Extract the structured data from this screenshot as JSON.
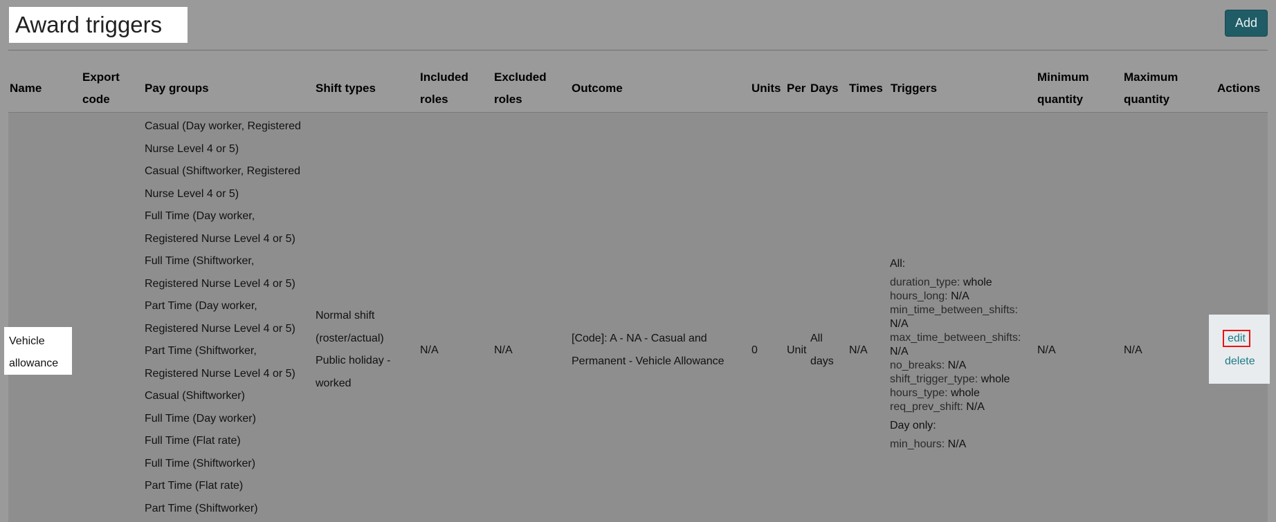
{
  "page": {
    "title": "Award triggers",
    "add_label": "Add"
  },
  "columns": {
    "name": [
      "Name"
    ],
    "export_code": [
      "Export",
      "code"
    ],
    "pay_groups": [
      "Pay groups"
    ],
    "shift_types": [
      "Shift types"
    ],
    "included_roles": [
      "Included",
      "roles"
    ],
    "excluded_roles": [
      "Excluded",
      "roles"
    ],
    "outcome": [
      "Outcome"
    ],
    "units": [
      "Units"
    ],
    "per": [
      "Per"
    ],
    "days": [
      "Days"
    ],
    "times": [
      "Times"
    ],
    "triggers": [
      "Triggers"
    ],
    "minimum_quantity": [
      "Minimum",
      "quantity"
    ],
    "maximum_quantity": [
      "Maximum",
      "quantity"
    ],
    "actions": [
      "Actions"
    ]
  },
  "row": {
    "name": [
      "Vehicle",
      "allowance"
    ],
    "pay_groups": [
      "Casual (Day worker, Registered",
      "Nurse Level 4 or 5)",
      "Casual (Shiftworker, Registered",
      "Nurse Level 4 or 5)",
      "Full Time (Day worker,",
      "Registered Nurse Level 4 or 5)",
      "Full Time (Shiftworker,",
      "Registered Nurse Level 4 or 5)",
      "Part Time (Day worker,",
      "Registered Nurse Level 4 or 5)",
      "Part Time (Shiftworker,",
      "Registered Nurse Level 4 or 5)",
      "Casual (Shiftworker)",
      "Full Time (Day worker)",
      "Full Time (Flat rate)",
      "Full Time (Shiftworker)",
      "Part Time (Flat rate)",
      "Part Time (Shiftworker)"
    ],
    "shift_types": [
      "Normal shift",
      "(roster/actual)",
      "Public holiday -",
      "worked"
    ],
    "included_roles": "N/A",
    "excluded_roles": "N/A",
    "outcome": [
      "[Code]: A - NA - Casual and",
      "Permanent - Vehicle Allowance"
    ],
    "units": "0",
    "per": "Unit",
    "days": [
      "All",
      "days"
    ],
    "times": "N/A",
    "triggers": {
      "all_label": "All:",
      "all_lines": [
        {
          "k": "duration_type:",
          "v": "whole"
        },
        {
          "k": "hours_long:",
          "v": "N/A"
        },
        {
          "k": "min_time_between_shifts:",
          "v": ""
        },
        {
          "k": "",
          "v": "N/A"
        },
        {
          "k": "max_time_between_shifts:",
          "v": ""
        },
        {
          "k": "",
          "v": "N/A"
        },
        {
          "k": "no_breaks:",
          "v": "N/A"
        },
        {
          "k": "shift_trigger_type:",
          "v": "whole"
        },
        {
          "k": "hours_type:",
          "v": "whole"
        },
        {
          "k": "req_prev_shift:",
          "v": "N/A"
        }
      ],
      "day_label": "Day only:",
      "day_lines": [
        {
          "k": "min_hours:",
          "v": "N/A"
        }
      ]
    },
    "minimum_quantity": "N/A",
    "maximum_quantity": "N/A",
    "actions": {
      "edit": "edit",
      "delete": "delete"
    }
  }
}
